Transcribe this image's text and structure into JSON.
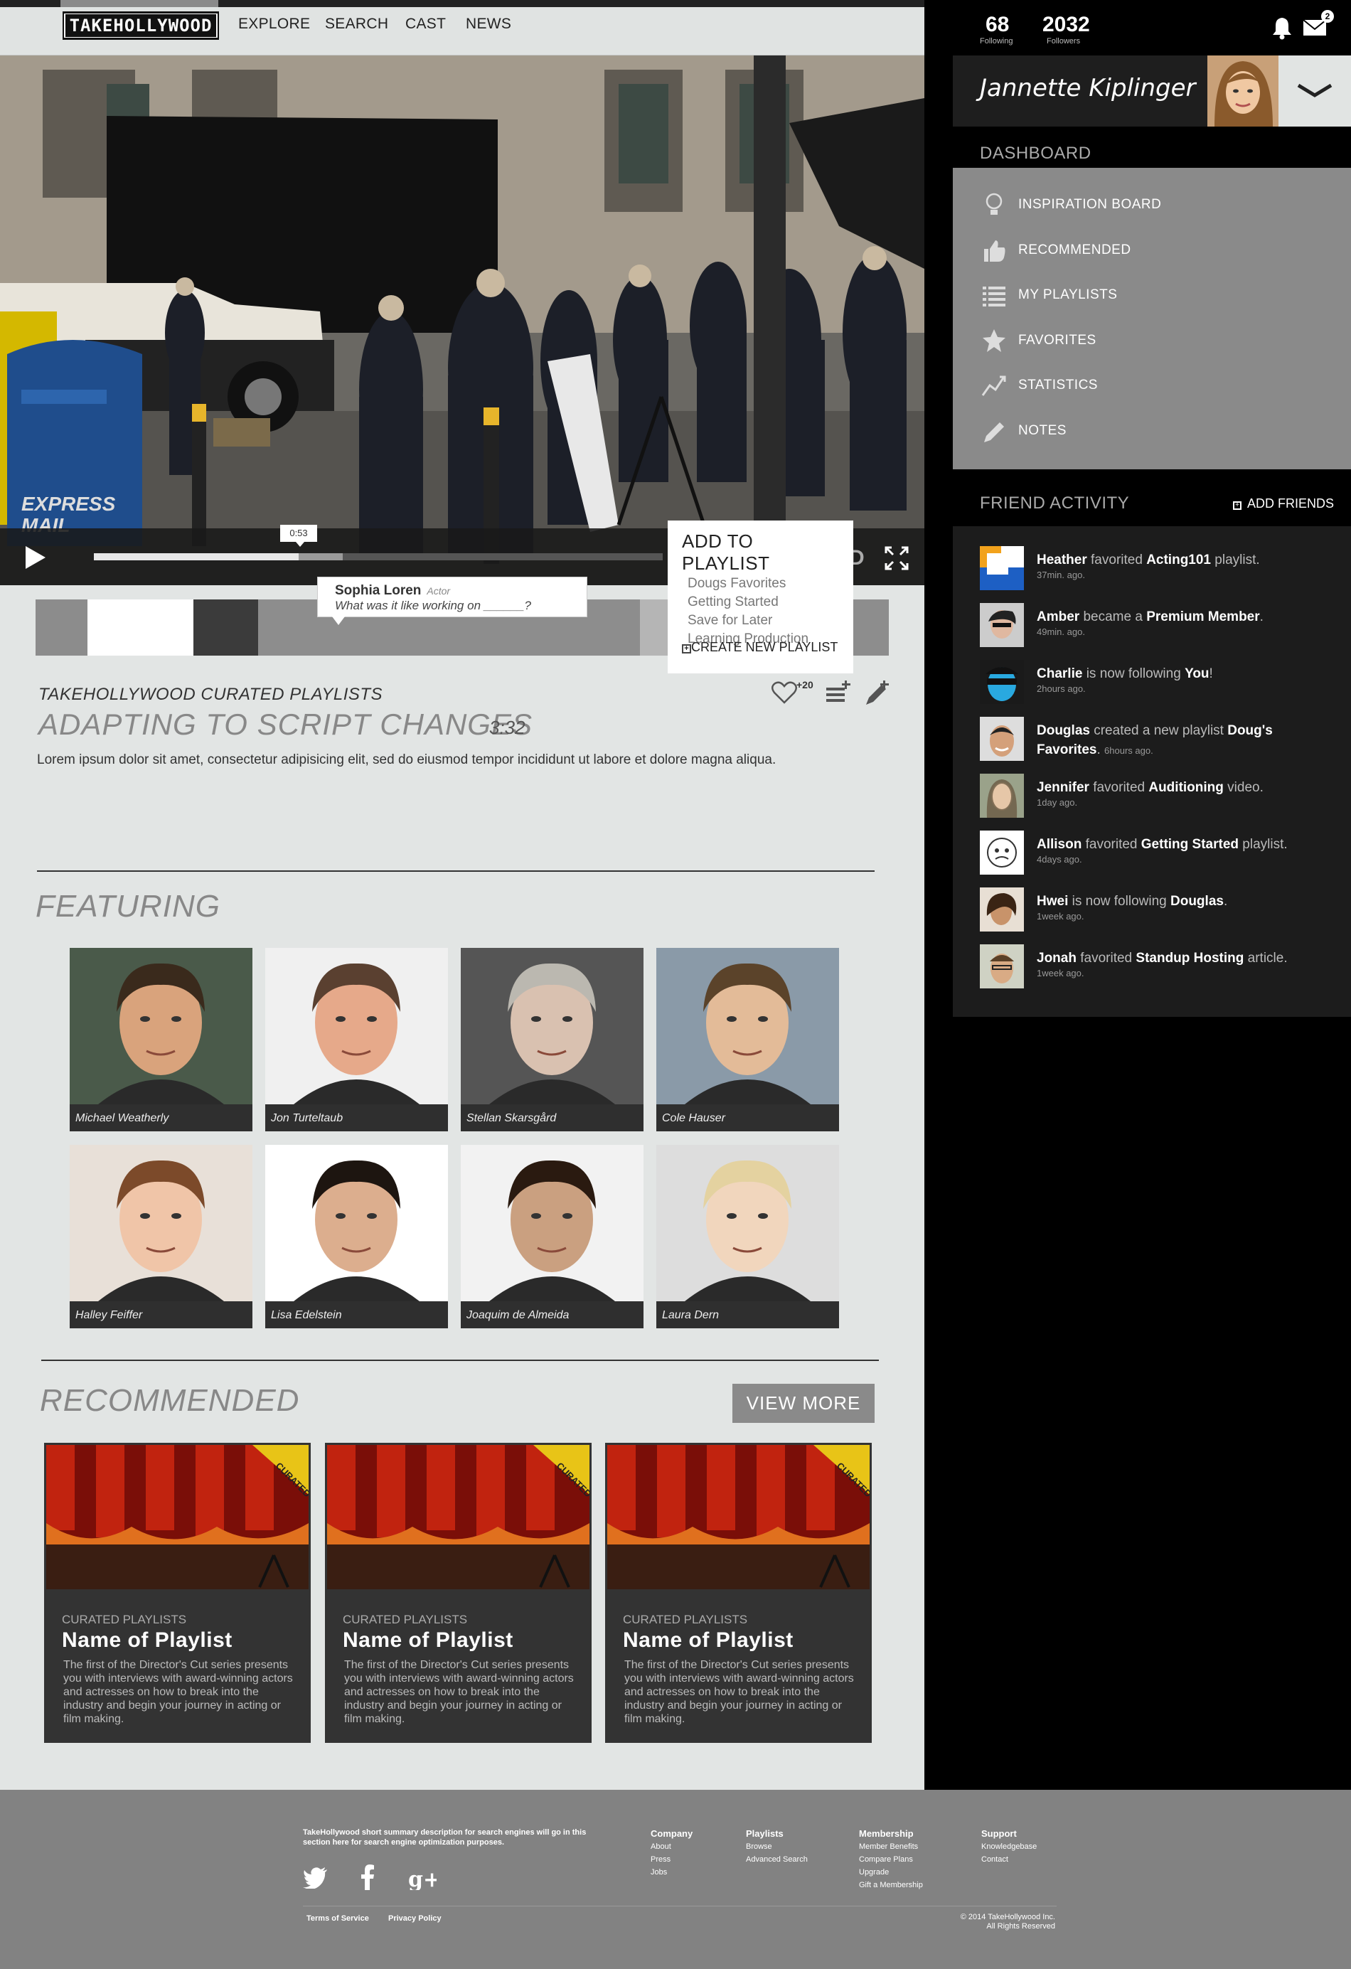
{
  "header": {
    "logo_text": "TAKEHOLLYWOOD",
    "nav": [
      "EXPLORE",
      "SEARCH",
      "CAST",
      "NEWS"
    ]
  },
  "video": {
    "current_time": "0:53",
    "progress_fraction": 0.36,
    "tooltip": {
      "name": "Sophia Loren",
      "role": "Actor",
      "question": "What was it like working on ______?"
    },
    "swatch_colors": [
      "#8c8c8c",
      "#ffffff",
      "#3b3b3b",
      "#8d8d8d",
      "#8d8d8d",
      "#8d8d8d",
      "#8d8d8d",
      "#b5b5b5",
      "#3b3b3b",
      "#8d8d8d",
      "#8d8d8d",
      "#ffffff",
      "#8d8d8d"
    ]
  },
  "add_to_playlist": {
    "title": "ADD TO PLAYLIST",
    "items": [
      "Dougs Favorites",
      "Getting Started",
      "Save for Later",
      "Learning Production"
    ],
    "create_label": "CREATE NEW PLAYLIST"
  },
  "video_info": {
    "category": "TAKEHOLLYWOOD CURATED PLAYLISTS",
    "title": "ADAPTING TO SCRIPT CHANGES",
    "duration": "3:32",
    "description": "Lorem ipsum dolor sit amet, consectetur adipisicing elit, sed do eiusmod tempor incididunt ut labore et dolore magna aliqua.",
    "like_count": "+20"
  },
  "featuring": {
    "title": "FEATURING",
    "actors": [
      "Michael Weatherly",
      "Jon Turteltaub",
      "Stellan Skarsgård",
      "Cole Hauser",
      "Halley Feiffer",
      "Lisa Edelstein",
      "Joaquim de Almeida",
      "Laura Dern"
    ]
  },
  "recommended": {
    "title": "RECOMMENDED",
    "view_more": "VIEW MORE",
    "badge": "CURATED",
    "cards": [
      {
        "label": "CURATED PLAYLISTS",
        "name": "Name of Playlist",
        "desc": "The first of the Director's Cut series presents you with interviews with award-winning actors and actresses on how to break into the industry and begin your journey in acting or film making."
      },
      {
        "label": "CURATED PLAYLISTS",
        "name": "Name of Playlist",
        "desc": "The first of the Director's Cut series presents you with interviews with award-winning actors and actresses on how to break into the industry and begin your journey in acting or film making."
      },
      {
        "label": "CURATED PLAYLISTS",
        "name": "Name of Playlist",
        "desc": "The first of the Director's Cut series presents you with interviews with award-winning actors and actresses on how to break into the industry and begin your journey in acting or film making."
      }
    ]
  },
  "sidebar": {
    "following_count": "68",
    "following_label": "Following",
    "followers_count": "2032",
    "followers_label": "Followers",
    "mail_badge": "2",
    "username": "Jannette Kiplinger",
    "dashboard_title": "DASHBOARD",
    "dashboard_items": [
      {
        "label": "INSPIRATION BOARD",
        "icon": "lightbulb-icon"
      },
      {
        "label": "RECOMMENDED",
        "icon": "thumbs-up-icon"
      },
      {
        "label": "MY PLAYLISTS",
        "icon": "list-icon"
      },
      {
        "label": "FAVORITES",
        "icon": "star-icon"
      },
      {
        "label": "STATISTICS",
        "icon": "chart-line-icon"
      },
      {
        "label": "NOTES",
        "icon": "pencil-icon"
      }
    ],
    "friend_activity_title": "FRIEND ACTIVITY",
    "add_friends": "ADD FRIENDS",
    "activity": [
      {
        "name": "Heather",
        "action": "favorited",
        "target": "Acting101",
        "suffix": "playlist.",
        "time": "37min. ago."
      },
      {
        "name": "Amber",
        "action": "became a",
        "target": "Premium Member",
        "suffix": ".",
        "time": "49min. ago."
      },
      {
        "name": "Charlie",
        "action": "is now following",
        "target": "You",
        "suffix": "!",
        "time": "2hours ago."
      },
      {
        "name": "Douglas",
        "action": "created a new playlist",
        "target": "Doug's Favorites",
        "suffix": ".",
        "time": "6hours ago."
      },
      {
        "name": "Jennifer",
        "action": "favorited",
        "target": "Auditioning",
        "suffix": "video.",
        "time": "1day ago."
      },
      {
        "name": "Allison",
        "action": "favorited",
        "target": "Getting Started",
        "suffix": "playlist.",
        "time": "4days ago."
      },
      {
        "name": "Hwei",
        "action": "is now following",
        "target": "Douglas",
        "suffix": ".",
        "time": "1week ago."
      },
      {
        "name": "Jonah",
        "action": "favorited",
        "target": "Standup Hosting",
        "suffix": "article.",
        "time": "1week ago."
      }
    ]
  },
  "footer": {
    "summary": "TakeHollywood short summary description for  search engines will go in this section here for search engine optimization purposes.",
    "columns": [
      {
        "heading": "Company",
        "links": [
          "About",
          "Press",
          "Jobs"
        ]
      },
      {
        "heading": "Playlists",
        "links": [
          "Browse",
          "Advanced Search"
        ]
      },
      {
        "heading": "Membership",
        "links": [
          "Member Benefits",
          "Compare Plans",
          "Upgrade",
          "Gift a Membership"
        ]
      },
      {
        "heading": "Support",
        "links": [
          "Knowledgebase",
          "Contact"
        ]
      }
    ],
    "terms": "Terms of Service",
    "privacy": "Privacy Policy",
    "copyright_line1": "© 2014 TakeHollywood Inc.",
    "copyright_line2": "All Rights Reserved"
  }
}
